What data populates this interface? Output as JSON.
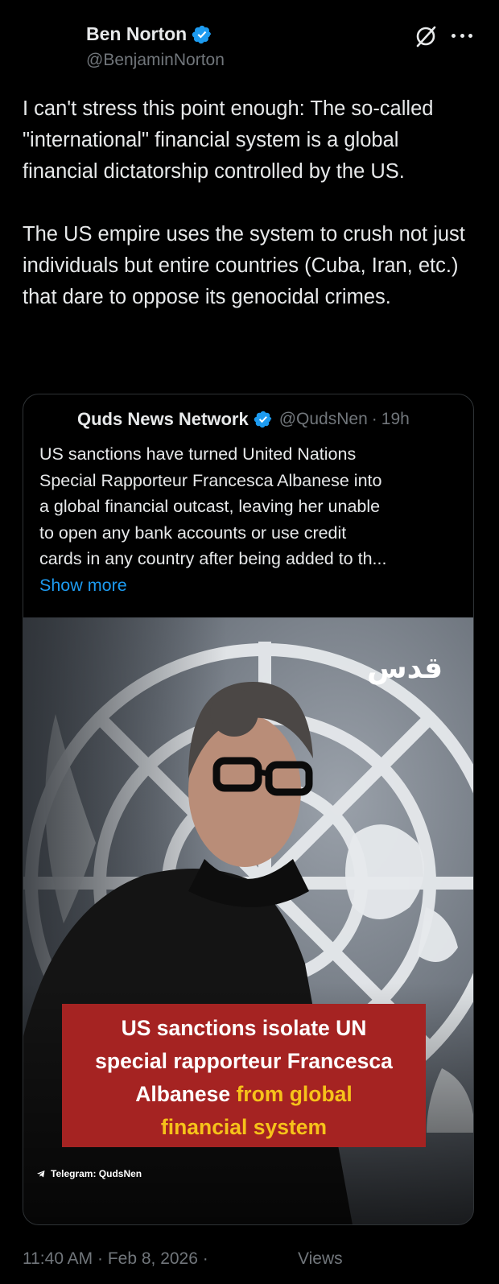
{
  "author": {
    "name": "Ben Norton",
    "handle": "@BenjaminNorton"
  },
  "tweet": {
    "paragraph_1": "I can't stress this point enough: The so-called \"international\" financial system is a global financial dictatorship controlled by the US.",
    "paragraph_2": "The US empire uses the system to crush not just individuals but entire countries (Cuba, Iran, etc.) that dare to oppose its genocidal crimes."
  },
  "quote": {
    "name": "Quds News Network",
    "handle": "@QudsNen",
    "separator": "·",
    "time": "19h",
    "text_lines": [
      "US sanctions have turned United Nations",
      "Special Rapporteur Francesca Albanese into",
      "a global financial outcast, leaving her unable",
      "to open any bank accounts or use credit",
      "cards in any country after being added to th..."
    ],
    "show_more": "Show more",
    "media": {
      "logo_text": "قدس",
      "caption": {
        "line_1": "US sanctions isolate UN",
        "line_2": "special rapporteur Francesca",
        "line_3_plain": "Albanese ",
        "line_3_highlight": "from global",
        "line_4_highlight": "financial system"
      },
      "telegram": "Telegram: QudsNen",
      "highlight_color": "#f6c21a",
      "caption_background": "#a52322"
    }
  },
  "footer": {
    "timestamp": "11:40 AM · Feb 8, 2026 ·",
    "views_label": "Views"
  },
  "colors": {
    "background": "#000000",
    "text": "#e7e9ea",
    "secondary": "#71767b",
    "link": "#1d9bf0",
    "verified": "#1d9bf0",
    "border": "#2f3336"
  },
  "icons": {
    "verified": "verified-badge-icon",
    "grok": "grok-icon",
    "more": "more-options-icon",
    "telegram": "telegram-icon"
  }
}
